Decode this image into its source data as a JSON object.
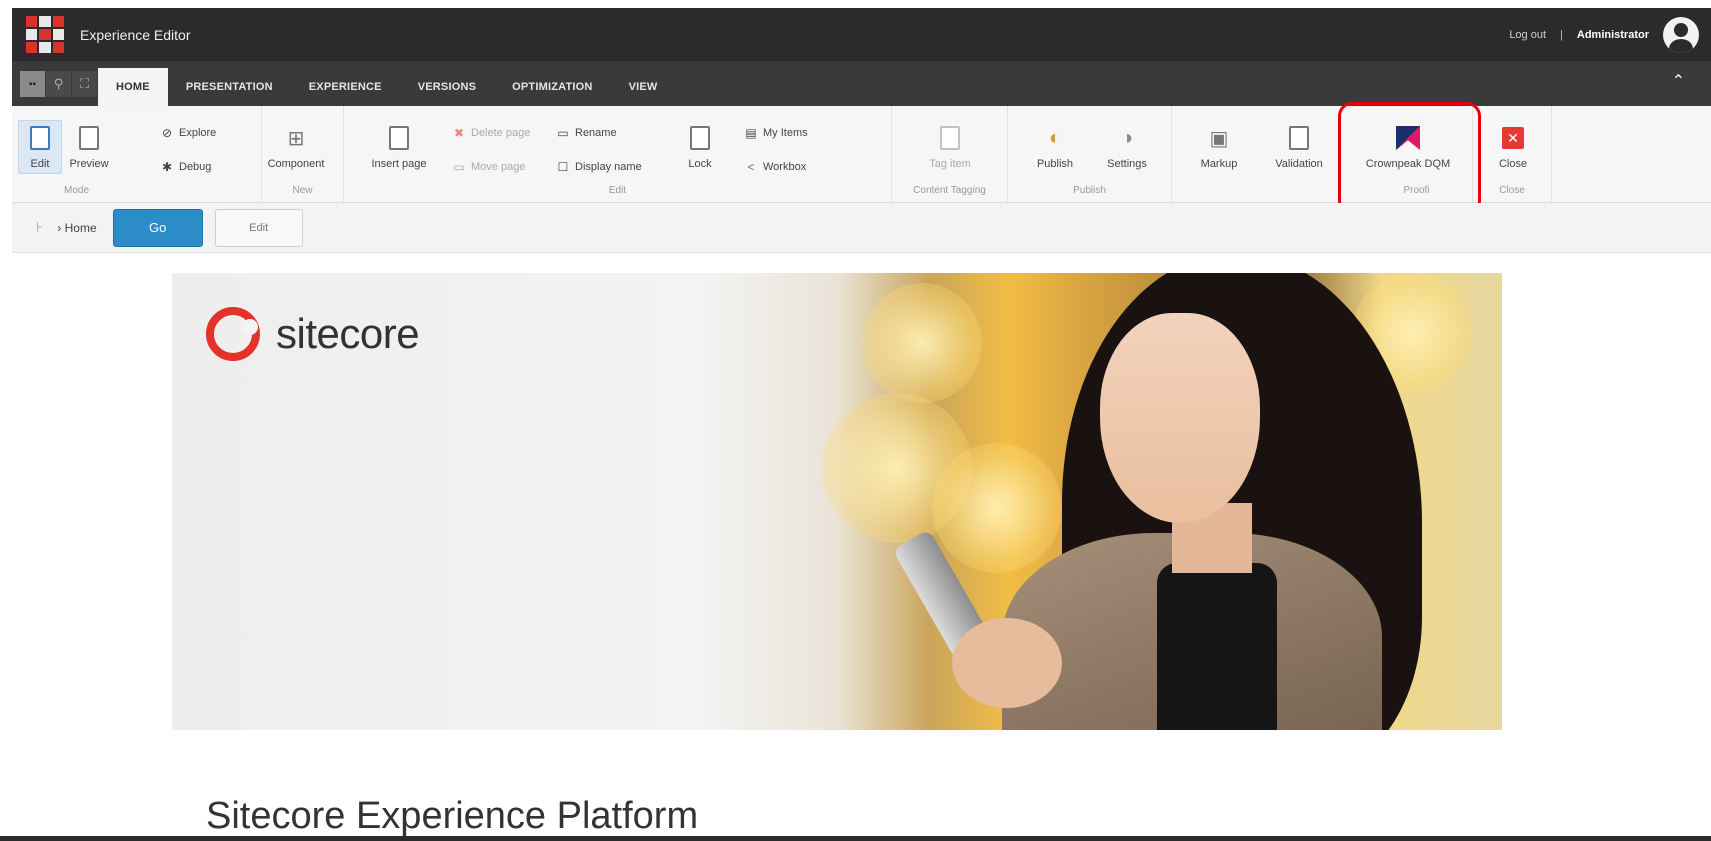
{
  "app": {
    "title": "Experience Editor",
    "logout_label": "Log out",
    "separator": "|",
    "user_name": "Administrator"
  },
  "tabs": [
    {
      "label": "HOME",
      "active": true
    },
    {
      "label": "PRESENTATION"
    },
    {
      "label": "EXPERIENCE"
    },
    {
      "label": "VERSIONS"
    },
    {
      "label": "OPTIMIZATION"
    },
    {
      "label": "VIEW"
    }
  ],
  "ribbon": {
    "mode": {
      "label": "Mode",
      "edit": "Edit",
      "preview": "Preview",
      "explore": "Explore",
      "debug": "Debug"
    },
    "new": {
      "label": "New",
      "component": "Component"
    },
    "edit": {
      "label": "Edit",
      "insert_page": "Insert page",
      "delete_page": "Delete page",
      "move_page": "Move page",
      "rename": "Rename",
      "display_name": "Display name",
      "lock": "Lock",
      "my_items": "My Items",
      "workbox": "Workbox"
    },
    "content_tagging": {
      "label": "Content Tagging",
      "tag_item": "Tag item"
    },
    "publish": {
      "label": "Publish",
      "publish": "Publish",
      "settings": "Settings"
    },
    "proofing": {
      "label": "Proofi",
      "markup": "Markup",
      "validation": "Validation",
      "crownpeak": "Crownpeak DQM"
    },
    "close": {
      "label": "Close",
      "close": "Close"
    }
  },
  "navbar": {
    "breadcrumb_sep": "›",
    "breadcrumb": "Home",
    "go_label": "Go",
    "edit_label": "Edit"
  },
  "hero": {
    "brand": "sitecore"
  },
  "page": {
    "heading": "Sitecore Experience Platform"
  },
  "colors": {
    "header_bg": "#2b2b2b",
    "tabbar_bg": "#3a3a3a",
    "ribbon_bg": "#f6f6f6",
    "accent_blue": "#2d8dc9",
    "highlight_red": "#e8000d",
    "brand_red": "#e4312a"
  }
}
